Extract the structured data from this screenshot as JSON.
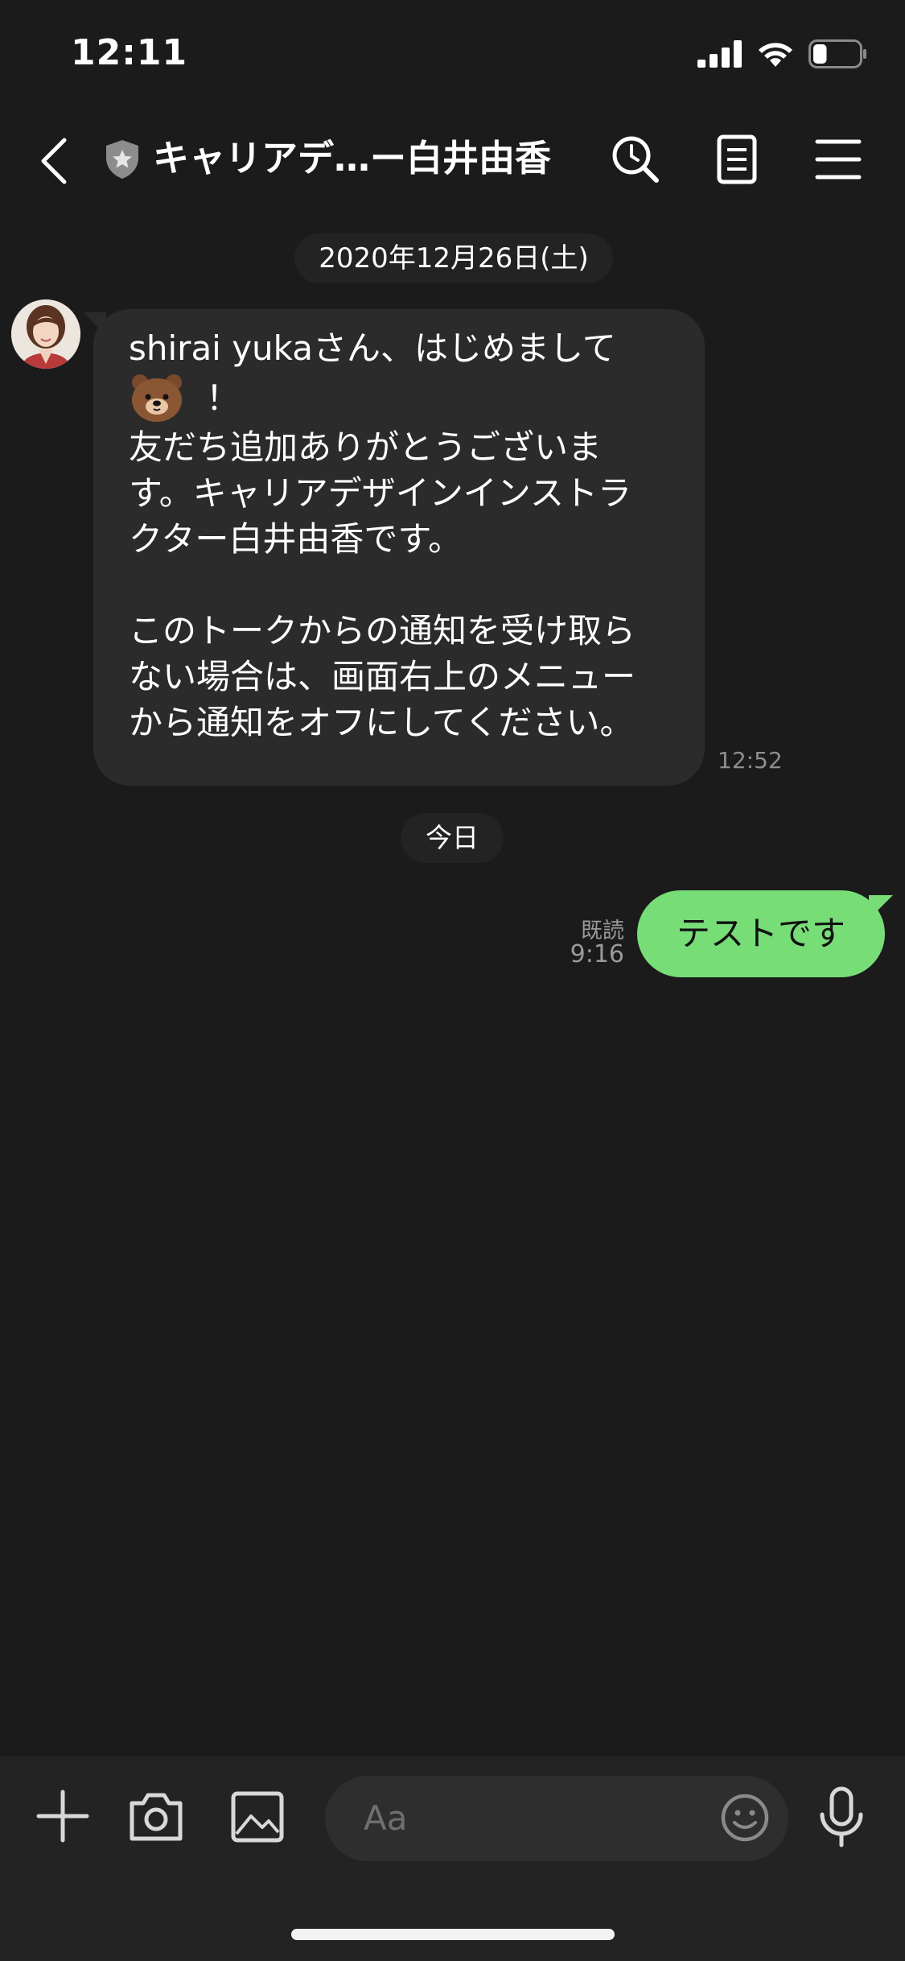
{
  "status_bar": {
    "time": "12:11",
    "battery_level": 0.3
  },
  "header": {
    "title": "キャリアデ…ー白井由香",
    "icons": [
      "back-icon",
      "shield-icon",
      "search-icon",
      "notes-icon",
      "menu-icon"
    ]
  },
  "chat": {
    "date_separator": "2020年12月26日(土)",
    "incoming": {
      "lines_before_bear": [
        "shirai yukaさん、はじめまして"
      ],
      "bear_suffix": "！",
      "lines_after_bear": [
        "友だち追加ありがとうございま",
        "す。キャリアデザインインストラ",
        "クター白井由香です。",
        "",
        "このトークからの通知を受け取ら",
        "ない場合は、画面右上のメニュー",
        "から通知をオフにしてください。"
      ],
      "time": "12:52"
    },
    "today_separator": "今日",
    "outgoing": {
      "text": "テストです",
      "read_label": "既読",
      "time": "9:16"
    }
  },
  "composer": {
    "placeholder": "Aa",
    "icons": [
      "plus-icon",
      "camera-icon",
      "image-icon",
      "emoji-icon",
      "microphone-icon"
    ]
  },
  "colors": {
    "background": "#1b1b1b",
    "incoming_bubble": "#2b2b2b",
    "outgoing_bubble": "#77dd77",
    "bar": "#232323"
  }
}
